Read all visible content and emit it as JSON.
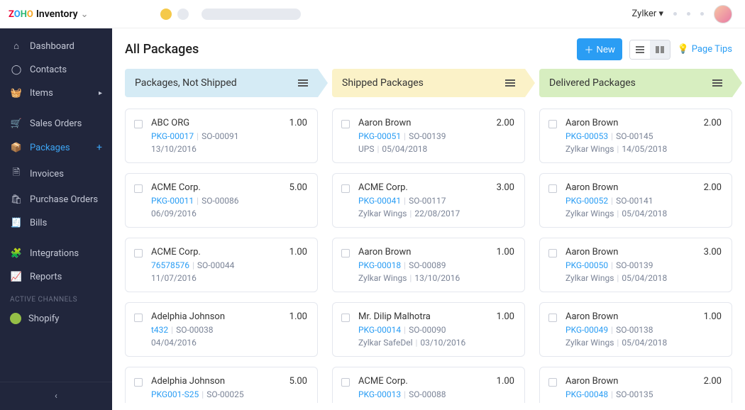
{
  "brand": {
    "name": "Inventory"
  },
  "topbar": {
    "org": "Zylker"
  },
  "header": {
    "title": "All Packages",
    "new_label": "New",
    "tips_label": "Page Tips"
  },
  "sidebar": {
    "items": [
      {
        "label": "Dashboard",
        "icon": "home-icon"
      },
      {
        "label": "Contacts",
        "icon": "user-icon"
      },
      {
        "label": "Items",
        "icon": "basket-icon",
        "chevron": true
      },
      {
        "label": "Sales Orders",
        "icon": "cart-icon"
      },
      {
        "label": "Packages",
        "icon": "box-icon",
        "active": true,
        "plus": true
      },
      {
        "label": "Invoices",
        "icon": "file-icon"
      },
      {
        "label": "Purchase Orders",
        "icon": "bag-icon"
      },
      {
        "label": "Bills",
        "icon": "receipt-icon"
      },
      {
        "label": "Integrations",
        "icon": "puzzle-icon"
      },
      {
        "label": "Reports",
        "icon": "chart-icon"
      }
    ],
    "channels_heading": "ACTIVE CHANNELS",
    "shopify": "Shopify"
  },
  "columns": [
    {
      "title": "Packages, Not Shipped",
      "color": "blue",
      "cards": [
        {
          "customer": "ABC ORG",
          "qty": "1.00",
          "pkg": "PKG-00017",
          "so": "SO-00091",
          "carrier": "",
          "date": "13/10/2016"
        },
        {
          "customer": "ACME Corp.",
          "qty": "5.00",
          "pkg": "PKG-00011",
          "so": "SO-00086",
          "carrier": "",
          "date": "06/09/2016"
        },
        {
          "customer": "ACME Corp.",
          "qty": "1.00",
          "pkg": "76578576",
          "so": "SO-00044",
          "carrier": "",
          "date": "11/07/2016"
        },
        {
          "customer": "Adelphia Johnson",
          "qty": "1.00",
          "pkg": "t432",
          "so": "SO-00038",
          "carrier": "",
          "date": "04/04/2016"
        },
        {
          "customer": "Adelphia Johnson",
          "qty": "5.00",
          "pkg": "PKG001-S25",
          "so": "SO-00025",
          "carrier": "",
          "date": ""
        }
      ]
    },
    {
      "title": "Shipped Packages",
      "color": "yellow",
      "cards": [
        {
          "customer": "Aaron Brown",
          "qty": "2.00",
          "pkg": "PKG-00051",
          "so": "SO-00139",
          "carrier": "UPS",
          "date": "05/04/2018"
        },
        {
          "customer": "ACME Corp.",
          "qty": "3.00",
          "pkg": "PKG-00041",
          "so": "SO-00117",
          "carrier": "Zylkar Wings",
          "date": "22/08/2017"
        },
        {
          "customer": "Aaron Brown",
          "qty": "1.00",
          "pkg": "PKG-00018",
          "so": "SO-00089",
          "carrier": "Zylkar Wings",
          "date": "13/10/2016"
        },
        {
          "customer": "Mr. Dilip Malhotra",
          "qty": "1.00",
          "pkg": "PKG-00014",
          "so": "SO-00090",
          "carrier": "Zylkar SafeDel",
          "date": "03/10/2016"
        },
        {
          "customer": "ACME Corp.",
          "qty": "1.00",
          "pkg": "PKG-00013",
          "so": "SO-00088",
          "carrier": "",
          "date": ""
        }
      ]
    },
    {
      "title": "Delivered Packages",
      "color": "green",
      "cards": [
        {
          "customer": "Aaron Brown",
          "qty": "2.00",
          "pkg": "PKG-00053",
          "so": "SO-00145",
          "carrier": "Zylkar Wings",
          "date": "14/05/2018"
        },
        {
          "customer": "Aaron Brown",
          "qty": "2.00",
          "pkg": "PKG-00052",
          "so": "SO-00141",
          "carrier": "Zylkar Wings",
          "date": "05/04/2018"
        },
        {
          "customer": "Aaron Brown",
          "qty": "3.00",
          "pkg": "PKG-00050",
          "so": "SO-00139",
          "carrier": "Zylkar Wings",
          "date": "05/04/2018"
        },
        {
          "customer": "Aaron Brown",
          "qty": "1.00",
          "pkg": "PKG-00049",
          "so": "SO-00138",
          "carrier": "Zylkar Wings",
          "date": "05/04/2018"
        },
        {
          "customer": "Aaron Brown",
          "qty": "2.00",
          "pkg": "PKG-00048",
          "so": "SO-00135",
          "carrier": "",
          "date": ""
        }
      ]
    }
  ]
}
